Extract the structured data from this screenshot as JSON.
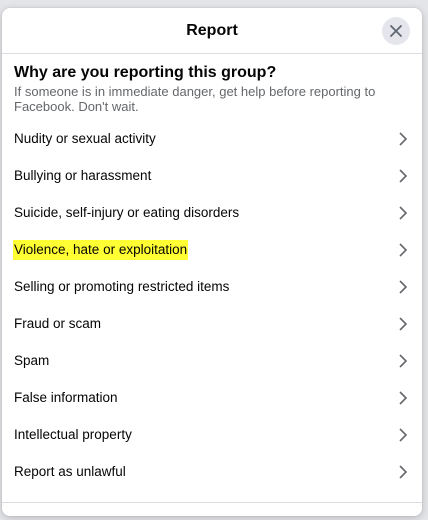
{
  "dialog": {
    "title": "Report",
    "question": "Why are you reporting this group?",
    "help_text": "If someone is in immediate danger, get help before reporting to Facebook. Don't wait."
  },
  "options": [
    {
      "label": "Nudity or sexual activity"
    },
    {
      "label": "Bullying or harassment"
    },
    {
      "label": "Suicide, self-injury or eating disorders"
    },
    {
      "label": "Violence, hate or exploitation"
    },
    {
      "label": "Selling or promoting restricted items"
    },
    {
      "label": "Fraud or scam"
    },
    {
      "label": "Spam"
    },
    {
      "label": "False information"
    },
    {
      "label": "Intellectual property"
    },
    {
      "label": "Report as unlawful"
    }
  ],
  "icons": {
    "close": "close-icon",
    "chevron": "chevron-right-icon"
  },
  "colors": {
    "highlight": "#ffff33",
    "text": "#050505",
    "secondary_text": "#65676b",
    "close_button_bg": "#e4e6eb"
  }
}
